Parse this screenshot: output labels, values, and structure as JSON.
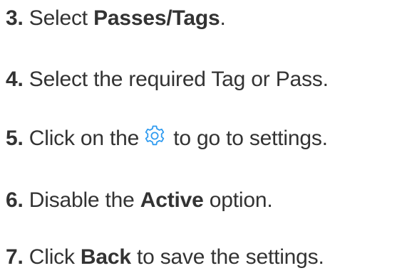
{
  "steps": [
    {
      "number": "3.",
      "text_before": "Select ",
      "bold": "Passes/Tags",
      "text_after": "."
    },
    {
      "number": "4.",
      "text": "Select the required Tag or Pass."
    },
    {
      "number": "5.",
      "text_before": "Click on the",
      "icon": "gear-icon",
      "text_after": " to go to settings."
    },
    {
      "number": "6.",
      "text_before": "Disable the ",
      "bold": "Active",
      "text_after": " option."
    },
    {
      "number": "7.",
      "text_before": "Click ",
      "bold": "Back",
      "text_after": " to save the settings."
    }
  ],
  "colors": {
    "text": "#333333",
    "icon": "#2f9bf0"
  }
}
